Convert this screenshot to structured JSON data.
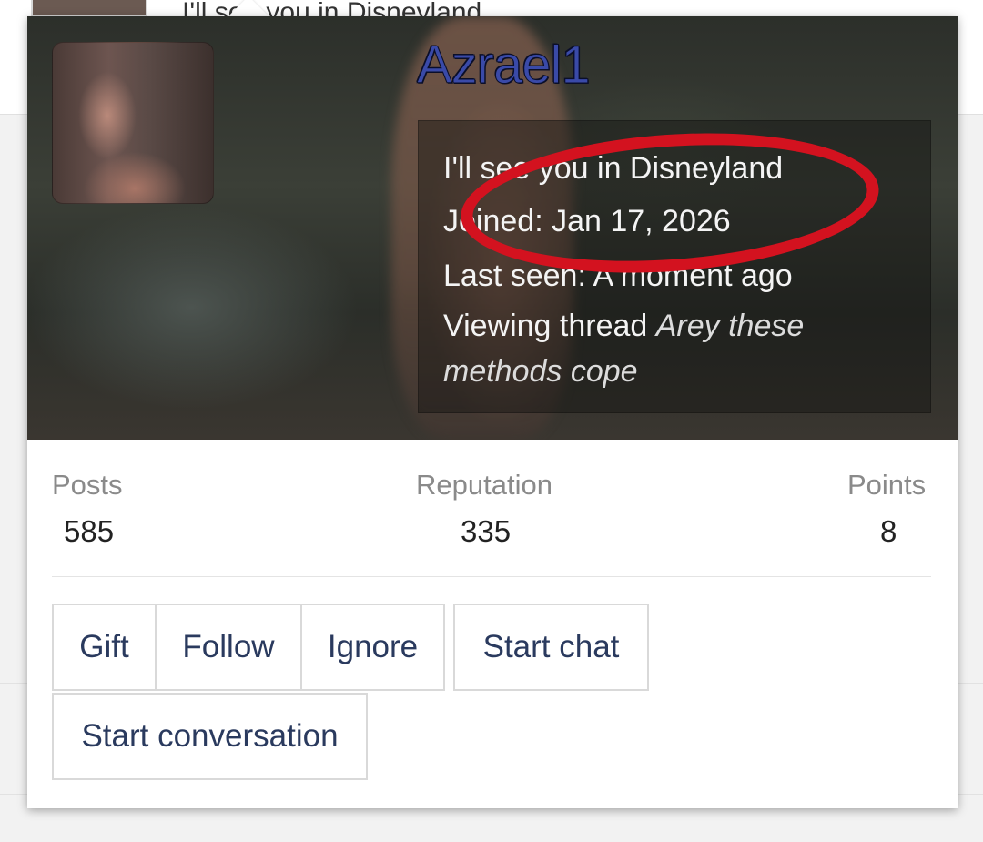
{
  "background": {
    "snippet": "I'll see you in Disneyland"
  },
  "profile": {
    "username": "Azrael1",
    "custom_title": "I'll see you in Disneyland",
    "joined": "Joined: Jan 17, 2026",
    "last_seen": "Last seen: A moment ago",
    "viewing_prefix": "Viewing thread ",
    "viewing_thread": "Arey these methods cope"
  },
  "stats": {
    "posts_label": "Posts",
    "posts_value": "585",
    "reputation_label": "Reputation",
    "reputation_value": "335",
    "points_label": "Points",
    "points_value": "8"
  },
  "actions": {
    "gift": "Gift",
    "follow": "Follow",
    "ignore": "Ignore",
    "start_chat": "Start chat",
    "start_conversation": "Start conversation"
  },
  "colors": {
    "username": "#3a4aa8",
    "button_text": "#2a3a5e",
    "annotation_circle": "#d3121f"
  }
}
